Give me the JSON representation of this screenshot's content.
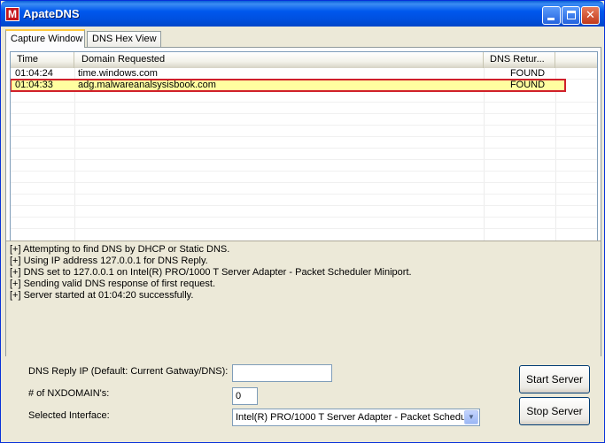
{
  "window": {
    "title": "ApateDNS",
    "icon": "malware-app-icon",
    "icon_glyph": "M",
    "controls": {
      "minimize": "minimize",
      "maximize": "maximize",
      "close_glyph": "✕"
    }
  },
  "tabs": [
    {
      "label": "Capture Window",
      "active": true
    },
    {
      "label": "DNS Hex View",
      "active": false
    }
  ],
  "table": {
    "columns": [
      "Time",
      "Domain Requested",
      "DNS Retur..."
    ],
    "rows": [
      {
        "time": "01:04:24",
        "domain": "time.windows.com",
        "dns": "FOUND"
      },
      {
        "time": "01:04:33",
        "domain": "adg.malwareanalsysisbook.com",
        "dns": "FOUND",
        "highlighted": true
      }
    ]
  },
  "log": [
    "[+] Attempting to find DNS by DHCP or Static DNS.",
    "[+] Using IP address 127.0.0.1 for DNS Reply.",
    "[+] DNS set to 127.0.0.1 on Intel(R) PRO/1000 T Server Adapter - Packet Scheduler Miniport.",
    "[+] Sending valid DNS response of first request.",
    "[+] Server started at 01:04:20 successfully."
  ],
  "form": {
    "dns_reply_label": "DNS Reply IP (Default: Current Gatway/DNS):",
    "dns_reply_value": "",
    "nxdomain_label": "# of NXDOMAIN's:",
    "nxdomain_value": "0",
    "interface_label": "Selected Interface:",
    "interface_value": "Intel(R) PRO/1000 T Server Adapter - Packet Schedu"
  },
  "buttons": {
    "start": "Start Server",
    "stop": "Stop Server"
  },
  "colors": {
    "highlight_row": "#ffffa0",
    "highlight_border": "#d0202a",
    "titlebar": "#0054e3"
  }
}
